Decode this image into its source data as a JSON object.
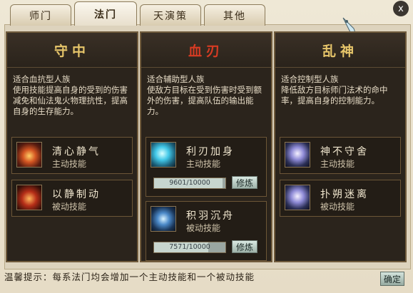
{
  "tabs": [
    {
      "label": "师门"
    },
    {
      "label": "法门"
    },
    {
      "label": "天演策"
    },
    {
      "label": "其他"
    }
  ],
  "close": "x",
  "columns": [
    {
      "title": "守中",
      "description": "适合血抗型人族\n使用技能提高自身的受到的伤害减免和仙法鬼火物理抗性，提高自身的生存能力。",
      "skills": [
        {
          "name": "清心静气",
          "type": "主动技能"
        },
        {
          "name": "以静制动",
          "type": "被动技能"
        }
      ]
    },
    {
      "title": "血刃",
      "description": "适合辅助型人族\n使敌方目标在受到伤害时受到额外的伤害，提高队伍的输出能力。",
      "skills": [
        {
          "name": "利刃加身",
          "type": "主动技能",
          "progress": "9601/10000",
          "progress_fraction": 0.9601,
          "button": "修炼"
        },
        {
          "name": "积羽沉舟",
          "type": "被动技能",
          "progress": "7571/10000",
          "progress_fraction": 0.7571,
          "button": "修炼"
        }
      ]
    },
    {
      "title": "乱神",
      "description": "适合控制型人族\n降低敌方目标师门法术的命中率，提高自身的控制能力。",
      "skills": [
        {
          "name": "神不守舍",
          "type": "主动技能"
        },
        {
          "name": "扑朔迷离",
          "type": "被动技能"
        }
      ]
    }
  ],
  "footer": {
    "tip": "温馨提示：每系法门均会增加一个主动技能和一个被动技能",
    "confirm_button": "确定"
  }
}
